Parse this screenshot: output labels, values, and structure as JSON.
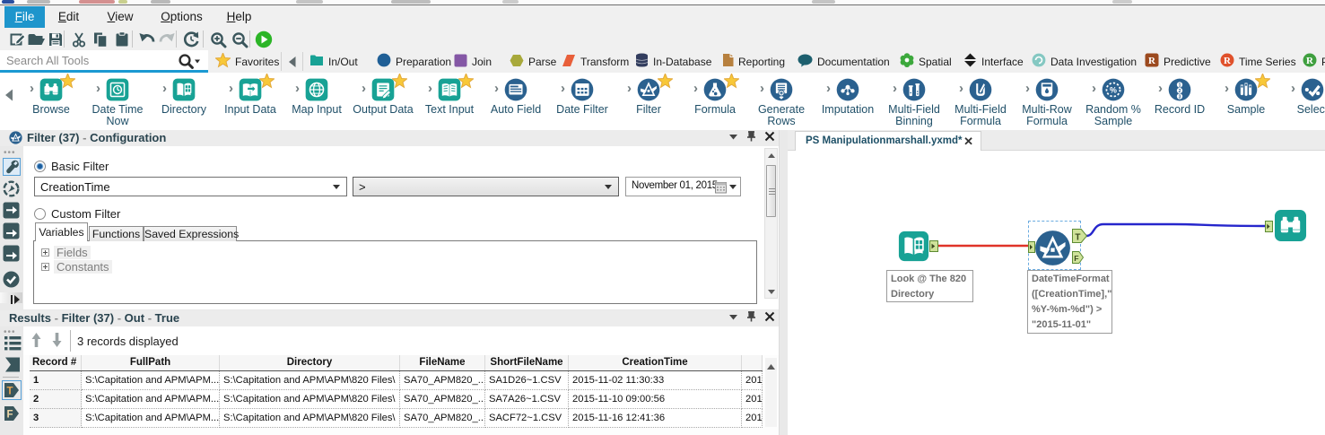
{
  "menu": {
    "items": [
      {
        "label": "File",
        "active": true
      },
      {
        "label": "Edit",
        "active": false
      },
      {
        "label": "View",
        "active": false
      },
      {
        "label": "Options",
        "active": false
      },
      {
        "label": "Help",
        "active": false
      }
    ]
  },
  "toolbar": {
    "buttons": [
      "new-file-icon",
      "open-folder-icon",
      "save-icon",
      "cut-icon",
      "copy-icon",
      "paste-icon",
      "undo-icon",
      "redo-icon",
      "refresh-icon",
      "zoom-in-icon",
      "zoom-out-icon",
      "run-icon"
    ]
  },
  "search": {
    "placeholder": "Search All Tools"
  },
  "categories": {
    "favorites_label": "Favorites",
    "items": [
      {
        "label": "In/Out",
        "icon": "folder",
        "color": "#18a295"
      },
      {
        "label": "Preparation",
        "icon": "circle",
        "color": "#1f5f96"
      },
      {
        "label": "Join",
        "icon": "square",
        "color": "#8457a5"
      },
      {
        "label": "Parse",
        "icon": "hexagon",
        "color": "#a8a93b"
      },
      {
        "label": "Transform",
        "icon": "ribbon",
        "color": "#e85f3a"
      },
      {
        "label": "In-Database",
        "icon": "database",
        "color": "#323d5e"
      },
      {
        "label": "Reporting",
        "icon": "document",
        "color": "#b7803e"
      },
      {
        "label": "Documentation",
        "icon": "bubble",
        "color": "#1d5f6e"
      },
      {
        "label": "Spatial",
        "icon": "flower",
        "color": "#3ca83c"
      },
      {
        "label": "Interface",
        "icon": "diamonds",
        "color": "#1a1a1a"
      },
      {
        "label": "Data Investigation",
        "icon": "circle-swirl",
        "color": "#85c8c2"
      },
      {
        "label": "Predictive",
        "icon": "r-square",
        "color": "#9c4a1f"
      },
      {
        "label": "Time Series",
        "icon": "r-circle",
        "color": "#e0512b"
      },
      {
        "label": "P",
        "icon": "r-circle",
        "color": "#3f9f3f"
      }
    ]
  },
  "palette": {
    "tools": [
      {
        "label": "Browse",
        "icon": "binoculars",
        "shape": "square",
        "favorite": true
      },
      {
        "label": "Date Time Now",
        "icon": "datetime",
        "shape": "square",
        "favorite": false
      },
      {
        "label": "Directory",
        "icon": "book-grid",
        "shape": "square",
        "favorite": false
      },
      {
        "label": "Input Data",
        "icon": "book-input",
        "shape": "square",
        "favorite": true
      },
      {
        "label": "Map Input",
        "icon": "globe",
        "shape": "square",
        "favorite": false
      },
      {
        "label": "Output Data",
        "icon": "page-out",
        "shape": "square",
        "favorite": true
      },
      {
        "label": "Text Input",
        "icon": "book-text",
        "shape": "square",
        "favorite": true
      },
      {
        "label": "Auto Field",
        "icon": "card",
        "shape": "circle",
        "favorite": false
      },
      {
        "label": "Date Filter",
        "icon": "calendar",
        "shape": "circle",
        "favorite": false
      },
      {
        "label": "Filter",
        "icon": "funnel-a",
        "shape": "circle",
        "favorite": true
      },
      {
        "label": "Formula",
        "icon": "flask",
        "shape": "circle",
        "favorite": true
      },
      {
        "label": "Generate Rows",
        "icon": "gen-rows",
        "shape": "circle",
        "favorite": false
      },
      {
        "label": "Imputation",
        "icon": "molecule",
        "shape": "circle",
        "favorite": false
      },
      {
        "label": "Multi-Field Binning",
        "icon": "jars",
        "shape": "circle",
        "favorite": false
      },
      {
        "label": "Multi-Field Formula",
        "icon": "beaker-pencil",
        "shape": "circle",
        "favorite": false
      },
      {
        "label": "Multi-Row Formula",
        "icon": "beaker-drop",
        "shape": "circle",
        "favorite": false
      },
      {
        "label": "Random % Sample",
        "icon": "percent-circle",
        "shape": "circle",
        "favorite": false
      },
      {
        "label": "Record ID",
        "icon": "numbers",
        "shape": "circle",
        "favorite": false
      },
      {
        "label": "Sample",
        "icon": "tubes",
        "shape": "circle",
        "favorite": true
      },
      {
        "label": "Select",
        "icon": "select-check",
        "shape": "circle",
        "favorite": false
      }
    ]
  },
  "config_panel": {
    "title": "Filter (37) - Configuration",
    "title_segments": [
      "Filter (37)",
      "Configuration"
    ],
    "basic_filter_label": "Basic Filter",
    "custom_filter_label": "Custom Filter",
    "field_value": "CreationTime",
    "operator_value": ">",
    "date_value": "November 01, 2015",
    "tabs": [
      "Variables",
      "Functions",
      "Saved Expressions"
    ],
    "active_tab": "Variables",
    "tree_items": [
      "Fields",
      "Constants"
    ],
    "strip_icons": [
      "wrench-icon",
      "compass-icon",
      "arrow-box-icon",
      "arrow-box-icon",
      "arrow-box-icon",
      "check-circle-icon"
    ]
  },
  "results_panel": {
    "title_segments": [
      "Results",
      "Filter (37)",
      "Out",
      "True"
    ],
    "status": "3 records displayed",
    "strip_icons": [
      "list-icon",
      "flag-icon",
      "t-badge",
      "f-badge"
    ],
    "grid": {
      "columns": [
        "Record #",
        "FullPath",
        "Directory",
        "FileName",
        "ShortFileName",
        "CreationTime",
        ""
      ],
      "rows": [
        [
          "1",
          "S:\\Capitation and APM\\APM...",
          "S:\\Capitation and APM\\APM\\820 Files\\",
          "SA70_APM820_...",
          "SA1D26~1.CSV",
          "2015-11-02 11:30:33",
          "201"
        ],
        [
          "2",
          "S:\\Capitation and APM\\APM...",
          "S:\\Capitation and APM\\APM\\820 Files\\",
          "SA70_APM820_...",
          "SA7A26~1.CSV",
          "2015-11-10 09:00:56",
          "201"
        ],
        [
          "3",
          "S:\\Capitation and APM\\APM...",
          "S:\\Capitation and APM\\APM\\820 Files\\",
          "SA70_APM820_...",
          "SACF72~1.CSV",
          "2015-11-16 12:41:36",
          "201"
        ]
      ]
    }
  },
  "canvas": {
    "tab_title": "PS Manipulationmarshall.yxmd*",
    "nodes": [
      {
        "name": "Directory",
        "icon": "book-grid",
        "annotation_lines": [
          "Look @ The 820",
          "Directory"
        ]
      },
      {
        "name": "Filter",
        "icon": "funnel-a",
        "annotation_lines": [
          "DateTimeFormat",
          "([CreationTime],\"",
          "%Y-%m-%d\") >",
          "\"2015-11-01\""
        ],
        "anchors": [
          "T",
          "F"
        ],
        "selected": true
      },
      {
        "name": "Browse",
        "icon": "binoculars"
      }
    ]
  },
  "colors": {
    "teal": "#18a295",
    "tool_blue": "#2b618f",
    "accent_blue": "#1e95cc",
    "run_green": "#2cb527",
    "wire_red": "#e03328",
    "wire_blue": "#2626cc",
    "anchor_green": "#cfe29a",
    "star_yellow": "#f8c838"
  }
}
